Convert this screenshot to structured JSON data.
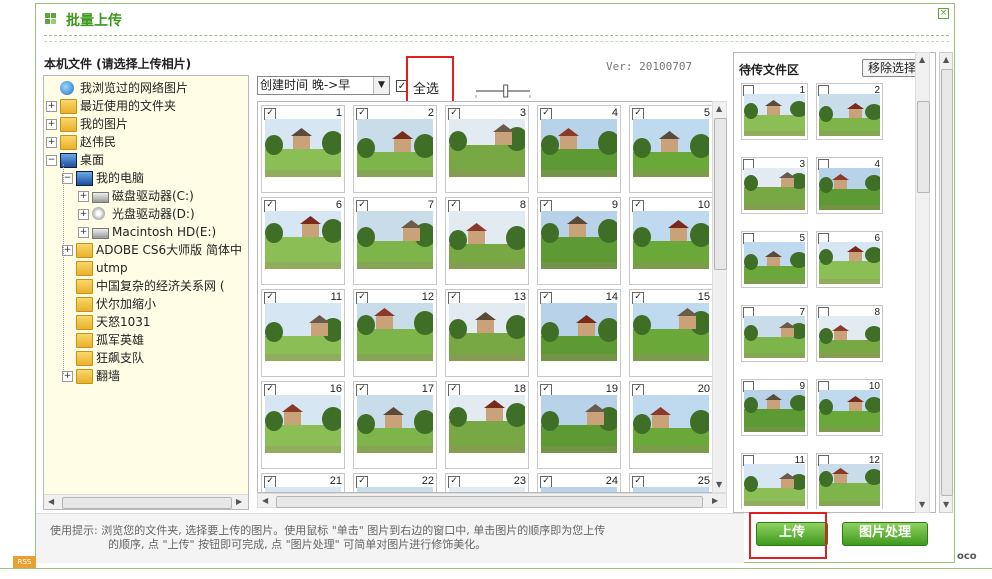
{
  "dialog": {
    "title": "批量上传",
    "close_glyph": "×"
  },
  "local": {
    "label": "本机文件 (请选择上传相片)",
    "tree": [
      {
        "label": "我浏览过的网络图片",
        "icon": "globe-icon",
        "level": 0,
        "expander": ""
      },
      {
        "label": "最近使用的文件夹",
        "icon": "folder-icon",
        "level": 0,
        "expander": "+"
      },
      {
        "label": "我的图片",
        "icon": "folder-icon",
        "level": 0,
        "expander": "+"
      },
      {
        "label": "赵伟民",
        "icon": "folder-icon",
        "level": 0,
        "expander": "+"
      },
      {
        "label": "桌面",
        "icon": "desktop-icon",
        "level": 0,
        "expander": "−"
      },
      {
        "label": "我的电脑",
        "icon": "computer-icon",
        "level": 1,
        "expander": "−"
      },
      {
        "label": "磁盘驱动器(C:)",
        "icon": "drive-icon",
        "level": 2,
        "expander": "+"
      },
      {
        "label": "光盘驱动器(D:)",
        "icon": "cdrom-icon",
        "level": 2,
        "expander": "+"
      },
      {
        "label": "Macintosh HD(E:)",
        "icon": "drive-icon",
        "level": 2,
        "expander": "+"
      },
      {
        "label": "ADOBE CS6大师版 简体中",
        "icon": "folder-icon",
        "level": 1,
        "expander": "+"
      },
      {
        "label": "utmp",
        "icon": "folder-icon",
        "level": 1,
        "expander": ""
      },
      {
        "label": "中国复杂的经济关系网 (",
        "icon": "folder-icon",
        "level": 1,
        "expander": ""
      },
      {
        "label": "伏尔加缩小",
        "icon": "folder-icon",
        "level": 1,
        "expander": ""
      },
      {
        "label": "天怒1031",
        "icon": "folder-icon",
        "level": 1,
        "expander": ""
      },
      {
        "label": "孤军英雄",
        "icon": "folder-icon",
        "level": 1,
        "expander": ""
      },
      {
        "label": "狂飙支队",
        "icon": "folder-icon",
        "level": 1,
        "expander": ""
      },
      {
        "label": "翻墙",
        "icon": "folder-icon",
        "level": 1,
        "expander": "+"
      }
    ]
  },
  "toolbar": {
    "sort_value": "创建时间 晚->早",
    "select_all_label": "全选",
    "select_all_checked": "✓",
    "slider_level": 0.55
  },
  "version": "Ver: 20100707",
  "grid": {
    "check_glyph": "✓",
    "items": [
      "1",
      "2",
      "3",
      "4",
      "5",
      "6",
      "7",
      "8",
      "9",
      "10",
      "11",
      "12",
      "13",
      "14",
      "15",
      "16",
      "17",
      "18",
      "19",
      "20",
      "21",
      "22",
      "23",
      "24",
      "25"
    ]
  },
  "pending": {
    "label": "待传文件区",
    "remove_label": "移除选择",
    "items": [
      "1",
      "2",
      "3",
      "4",
      "5",
      "6",
      "7",
      "8",
      "9",
      "10",
      "11",
      "12"
    ]
  },
  "tips": {
    "line1": "使用提示: 浏览您的文件夹, 选择要上传的图片。使用鼠标 \"单击\" 图片到右边的窗口中, 单击图片的顺序即为您上传",
    "line2": "的顺序, 点 \"上传\" 按钮即可完成, 点 \"图片处理\" 可简单对图片进行修饰美化。"
  },
  "actions": {
    "upload_label": "上传",
    "process_label": "图片处理"
  },
  "footer": {
    "rss_label": "RSS",
    "brand_fragment": "oco"
  },
  "colors": {
    "accent_green": "#3a9a19",
    "highlight_red": "#e02020"
  }
}
